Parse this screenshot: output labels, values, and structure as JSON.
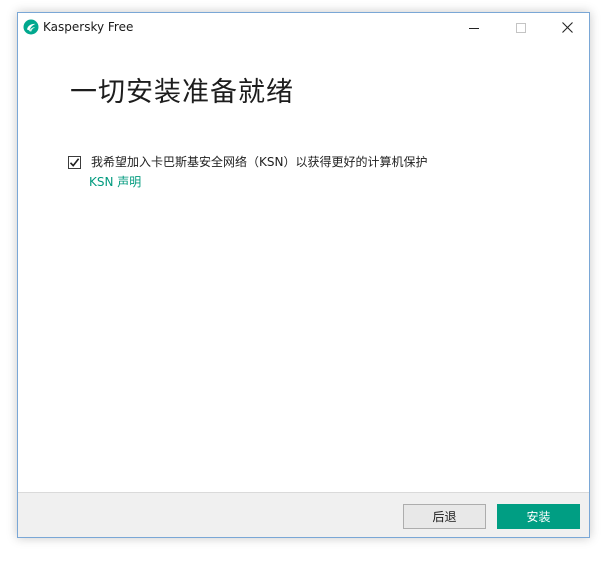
{
  "window": {
    "title": "Kaspersky Free",
    "icons": {
      "app": "kaspersky-logo-icon",
      "minimize": "minimize-icon",
      "maximize": "maximize-icon",
      "close": "close-icon"
    }
  },
  "main": {
    "heading": "一切安装准备就绪",
    "ksn_checkbox": {
      "checked": true,
      "label": "我希望加入卡巴斯基安全网络（KSN）以获得更好的计算机保护"
    },
    "ksn_link": "KSN 声明"
  },
  "footer": {
    "back_label": "后退",
    "install_label": "安装"
  },
  "colors": {
    "accent": "#009e83",
    "link": "#009a7e",
    "window_border": "#7aa7d6",
    "footer_bg": "#f0f0f0"
  }
}
